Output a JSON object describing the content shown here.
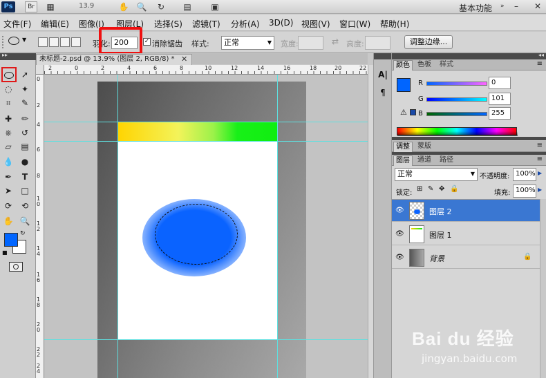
{
  "appbar": {
    "ps_label": "Ps",
    "br_label": "Br",
    "zoom": "13.9",
    "workspace": "基本功能",
    "icons": [
      "hand-icon",
      "zoom-icon",
      "rotate-icon",
      "arrange-icon",
      "screen-mode-icon"
    ]
  },
  "menu": [
    "文件(F)",
    "编辑(E)",
    "图像(I)",
    "图层(L)",
    "选择(S)",
    "滤镜(T)",
    "分析(A)",
    "3D(D)",
    "视图(V)",
    "窗口(W)",
    "帮助(H)"
  ],
  "options": {
    "feather_label": "羽化:",
    "feather_value": "200 px",
    "antialias_label": "消除锯齿",
    "antialias_checked": true,
    "style_label": "样式:",
    "style_value": "正常",
    "width_label": "宽度:",
    "height_label": "高度:",
    "refine_button": "调整边缘..."
  },
  "document": {
    "tab_title": "未标题-2.psd @ 13.9% (图层 2, RGB/8) *",
    "ruler_top": [
      "2",
      "0",
      "2",
      "4",
      "6",
      "8",
      "10",
      "12",
      "14",
      "16",
      "18",
      "20",
      "22"
    ],
    "ruler_left": [
      "0",
      "2",
      "4",
      "6",
      "8",
      "1\n0",
      "1\n2",
      "1\n4",
      "1\n6",
      "1\n8",
      "2\n0",
      "2\n2",
      "2\n4",
      "2\n6"
    ]
  },
  "color_panel": {
    "tabs": [
      "颜色",
      "色板",
      "样式"
    ],
    "r_label": "R",
    "g_label": "G",
    "b_label": "B",
    "r": "0",
    "g": "101",
    "b": "255",
    "foreground": "#0065ff"
  },
  "adjust_panel": {
    "tabs": [
      "调整",
      "蒙版"
    ]
  },
  "layers_panel": {
    "tabs": [
      "图层",
      "通道",
      "路径"
    ],
    "blend_mode": "正常",
    "opacity_label": "不透明度:",
    "opacity": "100%",
    "lock_label": "锁定:",
    "fill_label": "填充:",
    "fill": "100%",
    "layers": [
      {
        "name": "图层 2",
        "selected": true
      },
      {
        "name": "图层 1",
        "selected": false
      },
      {
        "name": "背景",
        "selected": false,
        "locked": true
      }
    ]
  },
  "watermark": {
    "brand": "Bai du 经验",
    "url": "jingyan.baidu.com"
  }
}
